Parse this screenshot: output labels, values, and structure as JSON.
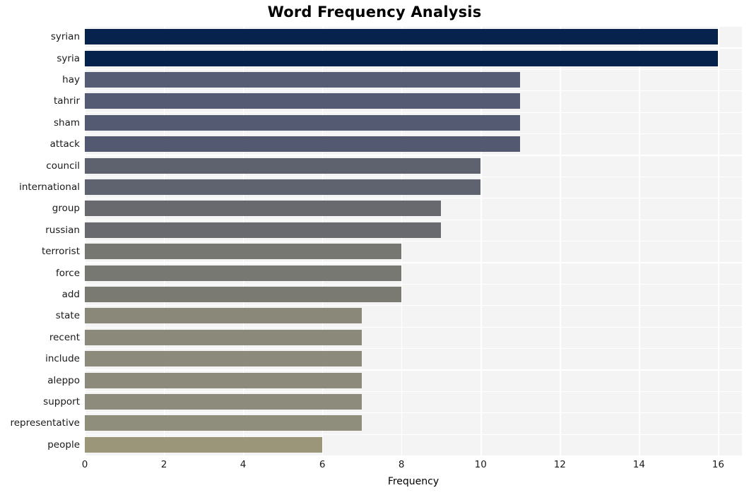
{
  "chart_data": {
    "type": "bar",
    "orientation": "horizontal",
    "title": "Word Frequency Analysis",
    "xlabel": "Frequency",
    "ylabel": "",
    "categories": [
      "syrian",
      "syria",
      "hay",
      "tahrir",
      "sham",
      "attack",
      "council",
      "international",
      "group",
      "russian",
      "terrorist",
      "force",
      "add",
      "state",
      "recent",
      "include",
      "aleppo",
      "support",
      "representative",
      "people"
    ],
    "values": [
      16,
      16,
      11,
      11,
      11,
      11,
      10,
      10,
      9,
      9,
      8,
      8,
      8,
      7,
      7,
      7,
      7,
      7,
      7,
      6
    ],
    "xlim": [
      0,
      16.6
    ],
    "xticks": [
      0,
      2,
      4,
      6,
      8,
      10,
      12,
      14,
      16
    ],
    "xtick_labels": [
      "0",
      "2",
      "4",
      "6",
      "8",
      "10",
      "12",
      "14",
      "16"
    ],
    "grid": true,
    "legend": null,
    "bar_colors": [
      "#06224d",
      "#05224c",
      "#565c73",
      "#555b72",
      "#545a71",
      "#535970",
      "#5e626f",
      "#5f636f",
      "#67696f",
      "#686a70",
      "#777771",
      "#787872",
      "#7a7a73",
      "#8a8878",
      "#8b8979",
      "#8c8a7a",
      "#8c8a7a",
      "#8d8b7b",
      "#8f8d7c",
      "#9b957a"
    ],
    "plot_background": "#f4f4f5",
    "grid_color": "#ffffff",
    "page_background": "#ffffff"
  }
}
